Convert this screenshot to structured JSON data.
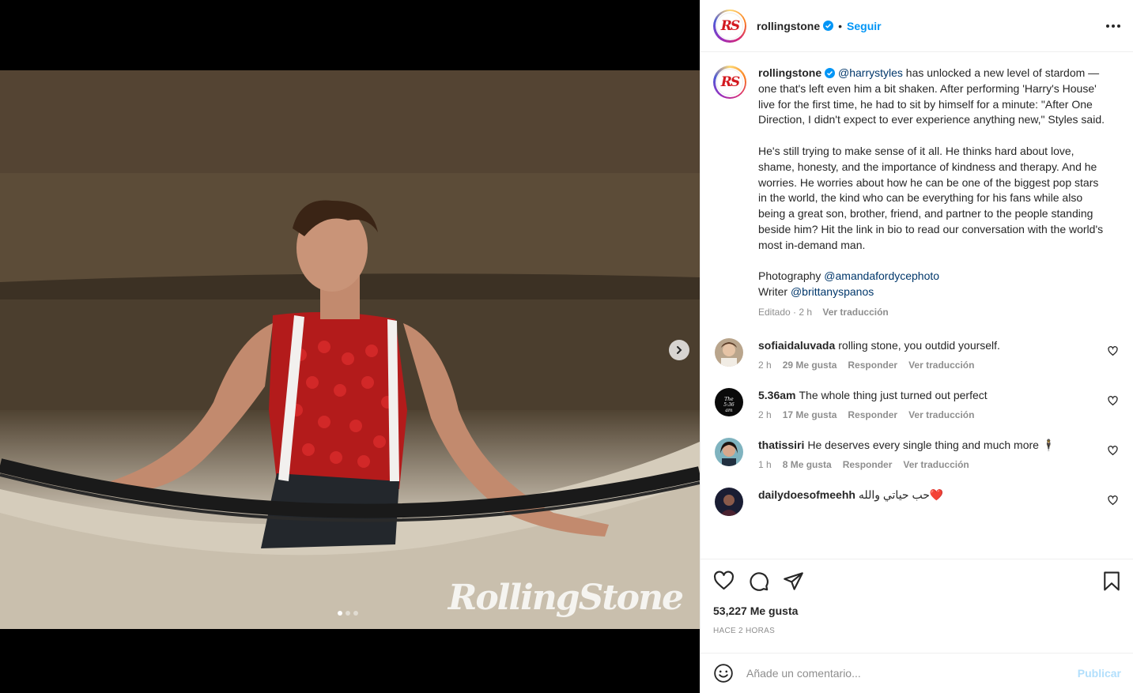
{
  "post": {
    "username": "rollingstone",
    "avatar_initials": "RS",
    "follow_label": "Seguir",
    "separator": "•",
    "image_watermark": "RollingStone",
    "carousel_count": 3,
    "carousel_active": 1
  },
  "caption": {
    "username": "rollingstone",
    "mention_lead": "@harrystyles",
    "p1_rest": " has unlocked a new level of stardom — one that's left even him a bit shaken. After performing 'Harry's House' live for the first time, he had to sit by himself for a minute: \"After One Direction, I didn't expect to ever experience anything new,\" Styles said.",
    "p2": "He's still trying to make sense of it all. He thinks hard about love, shame, honesty, and the importance of kindness and therapy. And he worries. He worries about how he can be one of the biggest pop stars in the world, the kind who can be everything for his fans while also being a great son, brother, friend, and partner to the people standing beside him? Hit the link in bio to read our conversation with the world's most in-demand man.",
    "photo_label": "Photography ",
    "photo_mention": "@amandafordycephoto",
    "writer_label": "Writer ",
    "writer_mention": "@brittanyspanos",
    "edited": "Editado · 2 h",
    "translate": "Ver traducción"
  },
  "comments": [
    {
      "user": "sofiaidaluvada",
      "text": "rolling stone, you outdid yourself.",
      "time": "2 h",
      "likes": "29 Me gusta",
      "reply": "Responder",
      "translate": "Ver traducción"
    },
    {
      "user": "5.36am",
      "text": "The whole thing just turned out perfect",
      "time": "2 h",
      "likes": "17 Me gusta",
      "reply": "Responder",
      "translate": "Ver traducción"
    },
    {
      "user": "thatissiri",
      "text": "He deserves every single thing and much more 🕴",
      "time": "1 h",
      "likes": "8 Me gusta",
      "reply": "Responder",
      "translate": "Ver traducción"
    },
    {
      "user": "dailydoesofmeehh",
      "text": "حب حياتي والله❤️",
      "time": "",
      "likes": "",
      "reply": "",
      "translate": ""
    }
  ],
  "actions": {
    "likes": "53,227 Me gusta",
    "ago": "HACE 2 HORAS"
  },
  "composer": {
    "placeholder": "Añade un comentario...",
    "publish": "Publicar"
  },
  "colors": {
    "link_blue": "#0095f6",
    "mention_blue": "#00376b",
    "muted": "#8e8e8e",
    "publish_disabled": "#b2dffc"
  }
}
